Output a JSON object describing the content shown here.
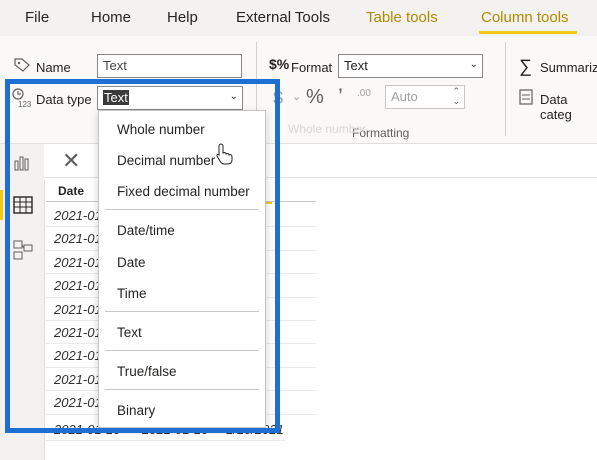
{
  "tabs": {
    "file": "File",
    "home": "Home",
    "help": "Help",
    "external_tools": "External Tools",
    "table_tools": "Table tools",
    "column_tools": "Column tools"
  },
  "ribbon": {
    "name_label": "Name",
    "name_value": "Text",
    "data_type_label": "Data type",
    "data_type_value": "Text",
    "format_label": "Format",
    "format_value": "Text",
    "currency_symbol": "$",
    "percent_symbol": "%",
    "comma_symbol": "’",
    "decimal_symbol": ".00",
    "auto_value": "Auto",
    "formatting_caption": "Formatting",
    "summarize_label": "Summariz",
    "data_category_label": "Data categ",
    "faded_ghost_text": "Whole number"
  },
  "table": {
    "header_date": "Date",
    "rows": [
      "2021-01",
      "2021-01",
      "2021-01",
      "2021-01",
      "2021-01",
      "2021-01",
      "2021-01",
      "2021-01",
      "2021-01"
    ],
    "last_row": [
      "2021-01-10",
      "2021-01-10",
      "1/10/2021"
    ]
  },
  "dropdown": {
    "items": [
      "Whole number",
      "Decimal number",
      "Fixed decimal number",
      "Date/time",
      "Date",
      "Time",
      "Text",
      "True/false",
      "Binary"
    ]
  },
  "colors": {
    "accent": "#f2c811",
    "highlight_border": "#1f6fd0",
    "tab_active_text": "#b08a00"
  }
}
